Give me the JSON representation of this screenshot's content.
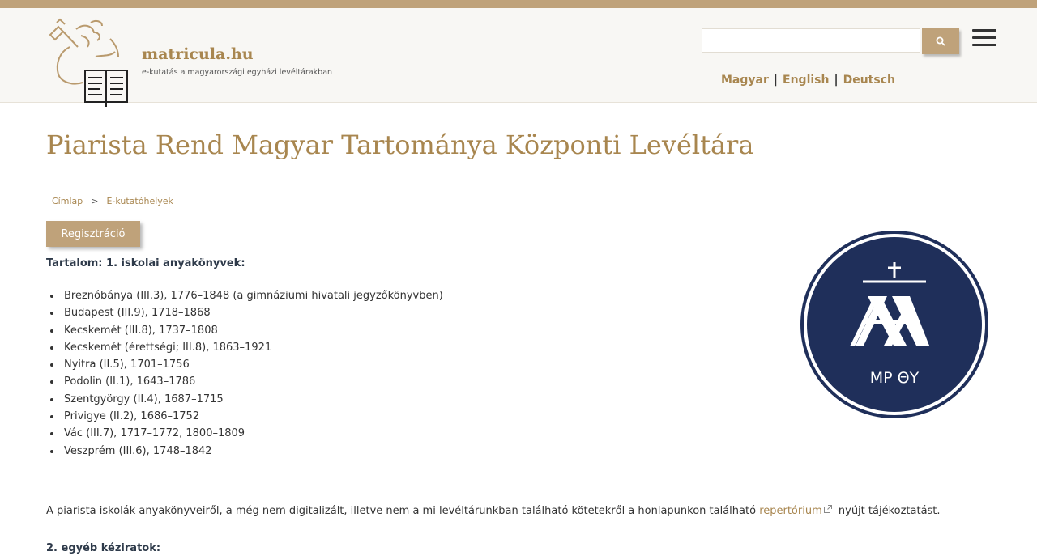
{
  "colors": {
    "accent": "#bfa27a",
    "accent_text": "#a8864f",
    "emblem_navy": "#1f2f5a"
  },
  "site": {
    "title": "matricula.hu",
    "subtitle": "e-kutatás a magyarországi egyházi levéltárakban"
  },
  "search": {
    "placeholder": "",
    "button_icon": "search-icon"
  },
  "menu": {
    "icon": "hamburger-menu-icon"
  },
  "languages": [
    "Magyar",
    "English",
    "Deutsch"
  ],
  "page": {
    "title": "Piarista Rend Magyar Tartománya Központi Levéltára",
    "breadcrumb": [
      "Címlap",
      "E-kutatóhelyek"
    ],
    "breadcrumb_separator": ">",
    "register_button": "Regisztráció"
  },
  "content": {
    "heading1": "Tartalom: 1. iskolai anyakönyvek:",
    "items": [
      "Breznóbánya (III.3), 1776–1848 (a gimnáziumi hivatali jegyzőkönyvben)",
      "Budapest (III.9), 1718–1868",
      "Kecskemét (III.8), 1737–1808",
      "Kecskemét (érettségi; III.8), 1863–1921",
      "Nyitra (II.5), 1701–1756",
      "Podolin (II.1), 1643–1786",
      "Szentgyörgy (II.4), 1687–1715",
      "Privigye (II.2), 1686–1752",
      "Vác (III.7), 1717–1772, 1800–1809",
      "Veszprém (III.6), 1748–1842"
    ],
    "paragraph_before_link": "A piarista iskolák anyakönyveiről, a még nem digitalizált, illetve nem a mi levéltárunkban található kötetekről a honlapunkon található ",
    "link_text": "repertórium",
    "paragraph_after_link": " nyújt tájékoztatást.",
    "heading2": "2. egyéb kéziratok:"
  },
  "emblem": {
    "text": "MP ΘY"
  }
}
